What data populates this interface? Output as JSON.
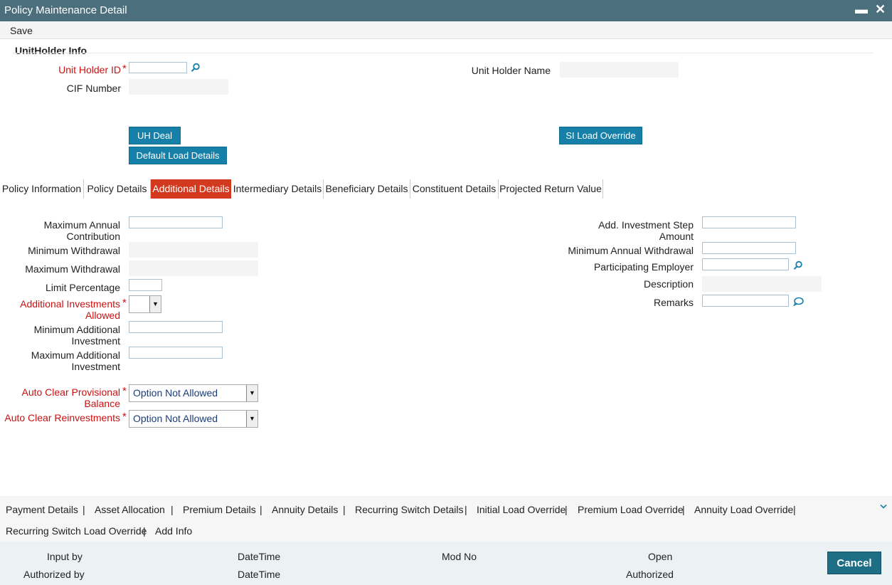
{
  "window": {
    "title": "Policy Maintenance Detail",
    "minimize_glyph": "▬",
    "close_glyph": "✕"
  },
  "toolbar": {
    "save_label": "Save"
  },
  "unitholder": {
    "section_title": "UnitHolder Info",
    "id_label": "Unit Holder ID",
    "id_value": "",
    "name_label": "Unit Holder Name",
    "name_value": "",
    "cif_label": "CIF Number",
    "cif_value": ""
  },
  "buttons": {
    "uh_deal": "UH Deal",
    "default_load": "Default Load Details",
    "si_load_override": "SI Load Override"
  },
  "tabs": [
    {
      "label": "Policy Information",
      "active": false
    },
    {
      "label": "Policy Details",
      "active": false
    },
    {
      "label": "Additional Details",
      "active": true
    },
    {
      "label": "Intermediary Details",
      "active": false
    },
    {
      "label": "Beneficiary Details",
      "active": false
    },
    {
      "label": "Constituent Details",
      "active": false
    },
    {
      "label": "Projected Return Value",
      "active": false
    }
  ],
  "left_fields": {
    "max_annual_contribution": {
      "label1": "Maximum Annual",
      "label2": "Contribution",
      "value": ""
    },
    "min_withdrawal": {
      "label": "Minimum Withdrawal",
      "value": ""
    },
    "max_withdrawal": {
      "label": "Maximum Withdrawal",
      "value": ""
    },
    "limit_percentage": {
      "label": "Limit Percentage",
      "value": ""
    },
    "additional_investments_allowed": {
      "label1": "Additional Investments",
      "label2": "Allowed",
      "value": ""
    },
    "min_additional_investment": {
      "label1": "Minimum Additional",
      "label2": "Investment",
      "value": ""
    },
    "max_additional_investment": {
      "label1": "Maximum Additional",
      "label2": "Investment",
      "value": ""
    },
    "auto_clear_provisional": {
      "label1": "Auto Clear Provisional",
      "label2": "Balance",
      "value": "Option Not Allowed"
    },
    "auto_clear_reinvestments": {
      "label": "Auto Clear Reinvestments",
      "value": "Option Not Allowed"
    }
  },
  "right_fields": {
    "add_investment_step": {
      "label1": "Add. Investment Step",
      "label2": "Amount",
      "value": ""
    },
    "min_annual_withdrawal": {
      "label": "Minimum Annual Withdrawal",
      "value": ""
    },
    "participating_employer": {
      "label": "Participating Employer",
      "value": ""
    },
    "description": {
      "label": "Description",
      "value": ""
    },
    "remarks": {
      "label": "Remarks",
      "value": ""
    }
  },
  "footer_links": {
    "row1": [
      "Payment Details",
      "Asset Allocation",
      "Premium Details",
      "Annuity Details",
      "Recurring Switch Details",
      "Initial Load Override",
      "Premium Load Override",
      "Annuity Load Override"
    ],
    "row2": [
      "Recurring Switch Load Override",
      "Add Info"
    ],
    "separator": "|"
  },
  "audit": {
    "input_by": "Input by",
    "datetime1": "DateTime",
    "mod_no": "Mod No",
    "open": "Open",
    "authorized_by": "Authorized by",
    "datetime2": "DateTime",
    "authorized": "Authorized"
  },
  "cancel_label": "Cancel",
  "colors": {
    "titlebar": "#4b6f7d",
    "button": "#1680a8",
    "active_tab": "#d2391e",
    "required": "#cc1111"
  }
}
